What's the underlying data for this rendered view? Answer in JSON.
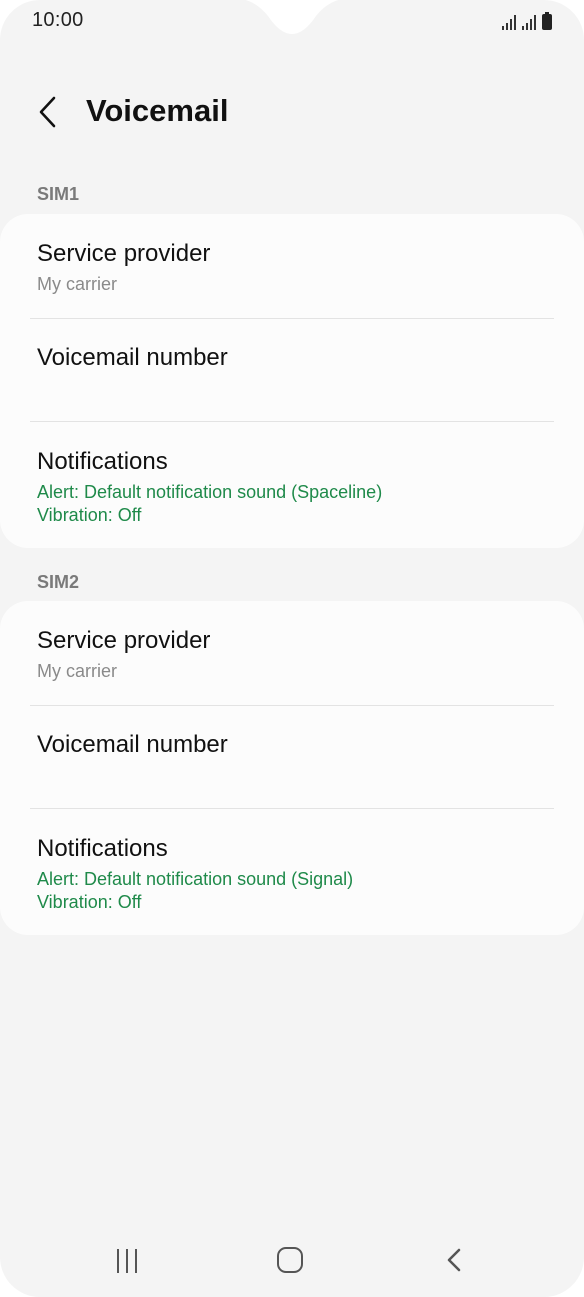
{
  "status_bar": {
    "time": "10:00",
    "icons": [
      "signal-sim1-icon",
      "signal-sim2-icon",
      "battery-icon"
    ]
  },
  "header": {
    "title": "Voicemail",
    "back_icon": "back-arrow-icon"
  },
  "sections": [
    {
      "label": "SIM1",
      "rows": [
        {
          "title": "Service provider",
          "subtitle": "My carrier"
        },
        {
          "title": "Voicemail number"
        },
        {
          "title": "Notifications",
          "alert": "Alert: Default notification sound (Spaceline)",
          "vibration": "Vibration: Off"
        }
      ]
    },
    {
      "label": "SIM2",
      "rows": [
        {
          "title": "Service provider",
          "subtitle": "My carrier"
        },
        {
          "title": "Voicemail number"
        },
        {
          "title": "Notifications",
          "alert": "Alert: Default notification sound (Signal)",
          "vibration": "Vibration: Off"
        }
      ]
    }
  ],
  "nav_bar": {
    "icons": [
      "recents-icon",
      "home-icon",
      "back-icon"
    ]
  },
  "colors": {
    "background": "#f4f4f4",
    "card": "#fcfcfc",
    "accent_green": "#1f8a4a",
    "secondary_text": "#8a8a8a"
  }
}
